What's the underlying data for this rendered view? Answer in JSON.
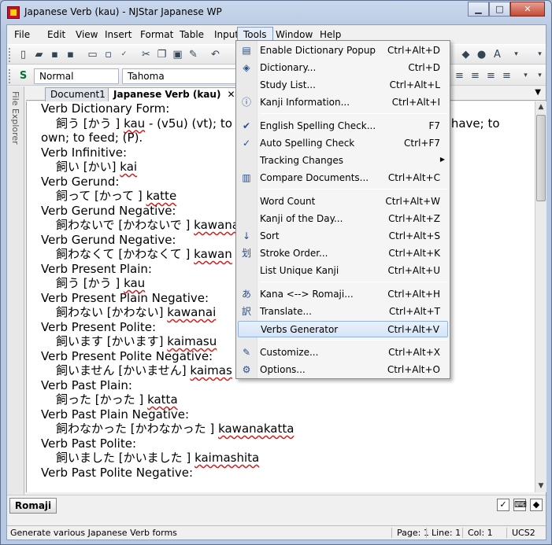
{
  "window": {
    "title": "Japanese Verb (kau) - NJStar Japanese WP",
    "controls": {
      "minimize": "▁",
      "maximize": "□",
      "close": "✕"
    }
  },
  "menubar": [
    "File",
    "Edit",
    "View",
    "Insert",
    "Format",
    "Table",
    "Input",
    "Tools",
    "Window",
    "Help"
  ],
  "toolbar2": {
    "style_value": "Normal",
    "font_value": "Tahoma"
  },
  "tabs": [
    {
      "label": "Document1 *"
    },
    {
      "label": "Japanese Verb (kau)",
      "close": "✕"
    }
  ],
  "side_panel": {
    "label": "File Explorer"
  },
  "document": {
    "lines": [
      {
        "t": "h",
        "text": "Verb Dictionary Form:"
      },
      {
        "t": "i",
        "jp": "飼う",
        "kana": "[かう ]",
        "rom": "kau",
        "rest": " - (v5u) (vt); to k",
        "tail": "to have; to"
      },
      {
        "t": "c",
        "text": "own; to feed; (P)."
      },
      {
        "t": "h",
        "text": "Verb Infinitive:"
      },
      {
        "t": "i",
        "jp": "飼い",
        "kana": "[かい]",
        "rom": "kai"
      },
      {
        "t": "h",
        "text": "Verb Gerund:"
      },
      {
        "t": "i",
        "jp": "飼って",
        "kana": "[かって ]",
        "rom": "katte"
      },
      {
        "t": "h",
        "text": "Verb Gerund Negative:"
      },
      {
        "t": "i",
        "jp": "飼わないで",
        "kana": "[かわないで ]",
        "rom": "kawana"
      },
      {
        "t": "h",
        "text": "Verb Gerund Negative:"
      },
      {
        "t": "i",
        "jp": "飼わなくて",
        "kana": "[かわなくて ]",
        "rom": "kawan"
      },
      {
        "t": "h",
        "text": "Verb Present Plain:"
      },
      {
        "t": "i",
        "jp": "飼う",
        "kana": "[かう ]",
        "rom": "kau"
      },
      {
        "t": "h",
        "text": "Verb Present Plain Negative:"
      },
      {
        "t": "i",
        "jp": "飼わない",
        "kana": "[かわない]",
        "rom": "kawanai"
      },
      {
        "t": "h",
        "text": "Verb Present Polite:"
      },
      {
        "t": "i",
        "jp": "飼います",
        "kana": "[かいます]",
        "rom": "kaimasu"
      },
      {
        "t": "h",
        "text": "Verb Present Polite Negative:"
      },
      {
        "t": "i",
        "jp": "飼いません",
        "kana": "[かいません]",
        "rom": "kaimas"
      },
      {
        "t": "h",
        "text": "Verb Past Plain:"
      },
      {
        "t": "i",
        "jp": "飼った",
        "kana": "[かった ]",
        "rom": "katta"
      },
      {
        "t": "h",
        "text": "Verb Past Plain Negative:"
      },
      {
        "t": "i",
        "jp": "飼わなかった",
        "kana": "[かわなかった ]",
        "rom": "kawanakatta"
      },
      {
        "t": "h",
        "text": "Verb Past Polite:"
      },
      {
        "t": "i",
        "jp": "飼いました",
        "kana": "[かいました ]",
        "rom": "kaimashita"
      },
      {
        "t": "h",
        "text": "Verb Past Polite Negative:"
      }
    ]
  },
  "tools_menu": [
    {
      "label": "Enable Dictionary Popup",
      "shortcut": "Ctrl+Alt+D",
      "icon": "dictionary-popup-icon",
      "glyph": "▤"
    },
    {
      "label": "Dictionary...",
      "shortcut": "Ctrl+D",
      "icon": "dictionary-icon",
      "glyph": "◈"
    },
    {
      "label": "Study List...",
      "shortcut": "Ctrl+Alt+L"
    },
    {
      "label": "Kanji Information...",
      "shortcut": "Ctrl+Alt+I",
      "icon": "info-icon",
      "glyph": "ⓘ"
    },
    {
      "sep": true
    },
    {
      "label": "English Spelling Check...",
      "shortcut": "F7",
      "icon": "spell-check-icon",
      "glyph": "✔"
    },
    {
      "label": "Auto Spelling Check",
      "shortcut": "Ctrl+F7",
      "icon": "checkmark-icon",
      "glyph": "✓"
    },
    {
      "label": "Tracking Changes",
      "shortcut": "",
      "submenu": true
    },
    {
      "label": "Compare Documents...",
      "shortcut": "Ctrl+Alt+C",
      "icon": "compare-icon",
      "glyph": "▥"
    },
    {
      "sep": true
    },
    {
      "label": "Word Count",
      "shortcut": "Ctrl+Alt+W"
    },
    {
      "label": "Kanji of the Day...",
      "shortcut": "Ctrl+Alt+Z"
    },
    {
      "label": "Sort",
      "shortcut": "Ctrl+Alt+S",
      "icon": "sort-icon",
      "glyph": "↓"
    },
    {
      "label": "Stroke Order...",
      "shortcut": "Ctrl+Alt+K",
      "icon": "stroke-order-icon",
      "glyph": "划"
    },
    {
      "label": "List Unique Kanji",
      "shortcut": "Ctrl+Alt+U"
    },
    {
      "sep": true
    },
    {
      "label": "Kana <--> Romaji...",
      "shortcut": "Ctrl+Alt+H",
      "icon": "kana-romaji-icon",
      "glyph": "あ"
    },
    {
      "label": "Translate...",
      "shortcut": "Ctrl+Alt+T",
      "icon": "translate-icon",
      "glyph": "訳"
    },
    {
      "label": "Verbs Generator",
      "shortcut": "Ctrl+Alt+V",
      "highlighted": true
    },
    {
      "sep": true
    },
    {
      "label": "Customize...",
      "shortcut": "Ctrl+Alt+X",
      "icon": "customize-icon",
      "glyph": "✎"
    },
    {
      "label": "Options...",
      "shortcut": "Ctrl+Alt+O",
      "icon": "options-gear-icon",
      "glyph": "⚙"
    }
  ],
  "modebar": {
    "mode_label": "Romaji"
  },
  "statusbar": {
    "message": "Generate various Japanese Verb forms",
    "page": "Page: 1",
    "line": "Line: 1",
    "col": "Col: 1",
    "encoding": "UCS2"
  }
}
